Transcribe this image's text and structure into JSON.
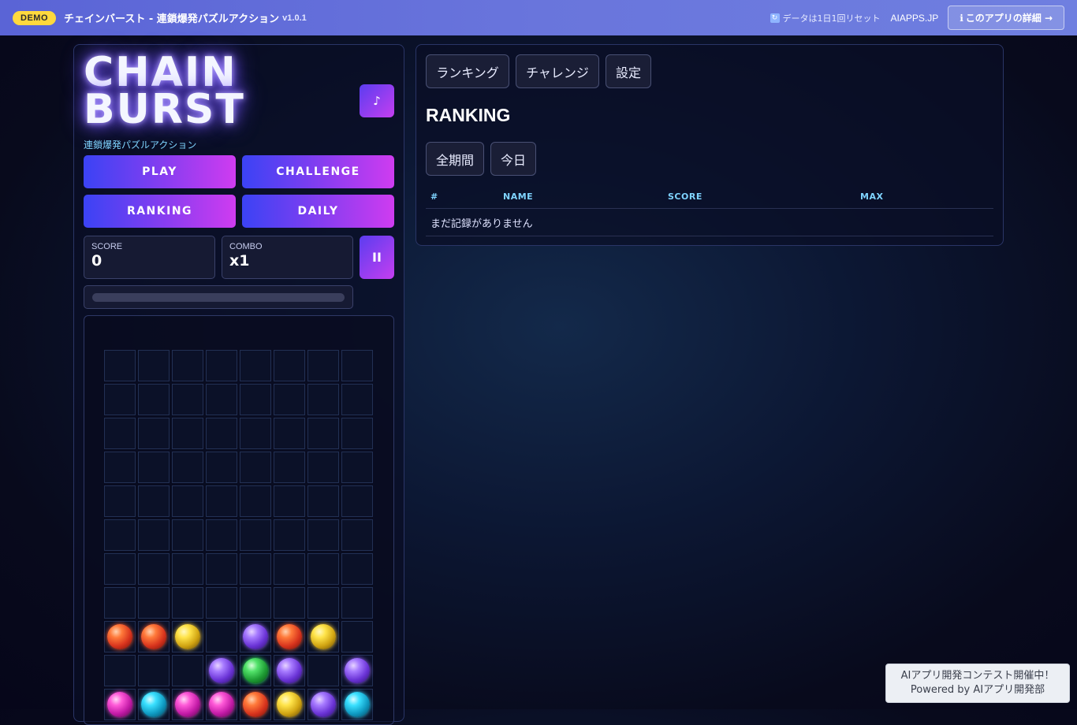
{
  "topbar": {
    "badge": "DEMO",
    "title": "チェインバースト - 連鎖爆発パズルアクション",
    "version": "v1.0.1",
    "reset_note": "データは1日1回リセット",
    "brand": "AIAPPS.JP",
    "detail_button": "このアプリの詳細 →"
  },
  "game": {
    "logo_line1": "CHAIN",
    "logo_line2": "BURST",
    "subtitle": "連鎖爆発パズルアクション",
    "music_icon": "♪",
    "menu": {
      "play": "PLAY",
      "challenge": "CHALLENGE",
      "ranking": "RANKING",
      "daily": "DAILY"
    },
    "score_label": "SCORE",
    "score_value": "0",
    "combo_label": "COMBO",
    "combo_value": "x1",
    "pause_icon": "II",
    "progress": 0,
    "board_rows": [
      [
        "",
        "",
        "",
        "",
        "",
        "",
        "",
        ""
      ],
      [
        "",
        "",
        "",
        "",
        "",
        "",
        "",
        ""
      ],
      [
        "",
        "",
        "",
        "",
        "",
        "",
        "",
        ""
      ],
      [
        "",
        "",
        "",
        "",
        "",
        "",
        "",
        ""
      ],
      [
        "",
        "",
        "",
        "",
        "",
        "",
        "",
        ""
      ],
      [
        "",
        "",
        "",
        "",
        "",
        "",
        "",
        ""
      ],
      [
        "",
        "",
        "",
        "",
        "",
        "",
        "",
        ""
      ],
      [
        "",
        "",
        "",
        "",
        "",
        "",
        "",
        ""
      ],
      [
        "red",
        "red",
        "yellow",
        "",
        "purple",
        "red",
        "yellow",
        ""
      ],
      [
        "",
        "",
        "",
        "purple",
        "green",
        "purple",
        "",
        "purple"
      ],
      [
        "pink",
        "cyan",
        "pink",
        "pink",
        "red",
        "yellow",
        "purple",
        "cyan"
      ]
    ]
  },
  "panel": {
    "tabs": [
      "ランキング",
      "チャレンジ",
      "設定"
    ],
    "title": "RANKING",
    "filters": [
      "全期間",
      "今日"
    ],
    "columns": [
      "#",
      "NAME",
      "SCORE",
      "MAX"
    ],
    "empty_text": "まだ記録がありません"
  },
  "contest": {
    "line1": "AIアプリ開発コンテスト開催中！",
    "line2": "Powered by AIアプリ開発部"
  },
  "colors": {
    "accent_start": "#3b43f4",
    "accent_end": "#cf3cf0",
    "topbar": "#6370da",
    "badge": "#ffd93d",
    "table_header": "#7fd4ff"
  }
}
